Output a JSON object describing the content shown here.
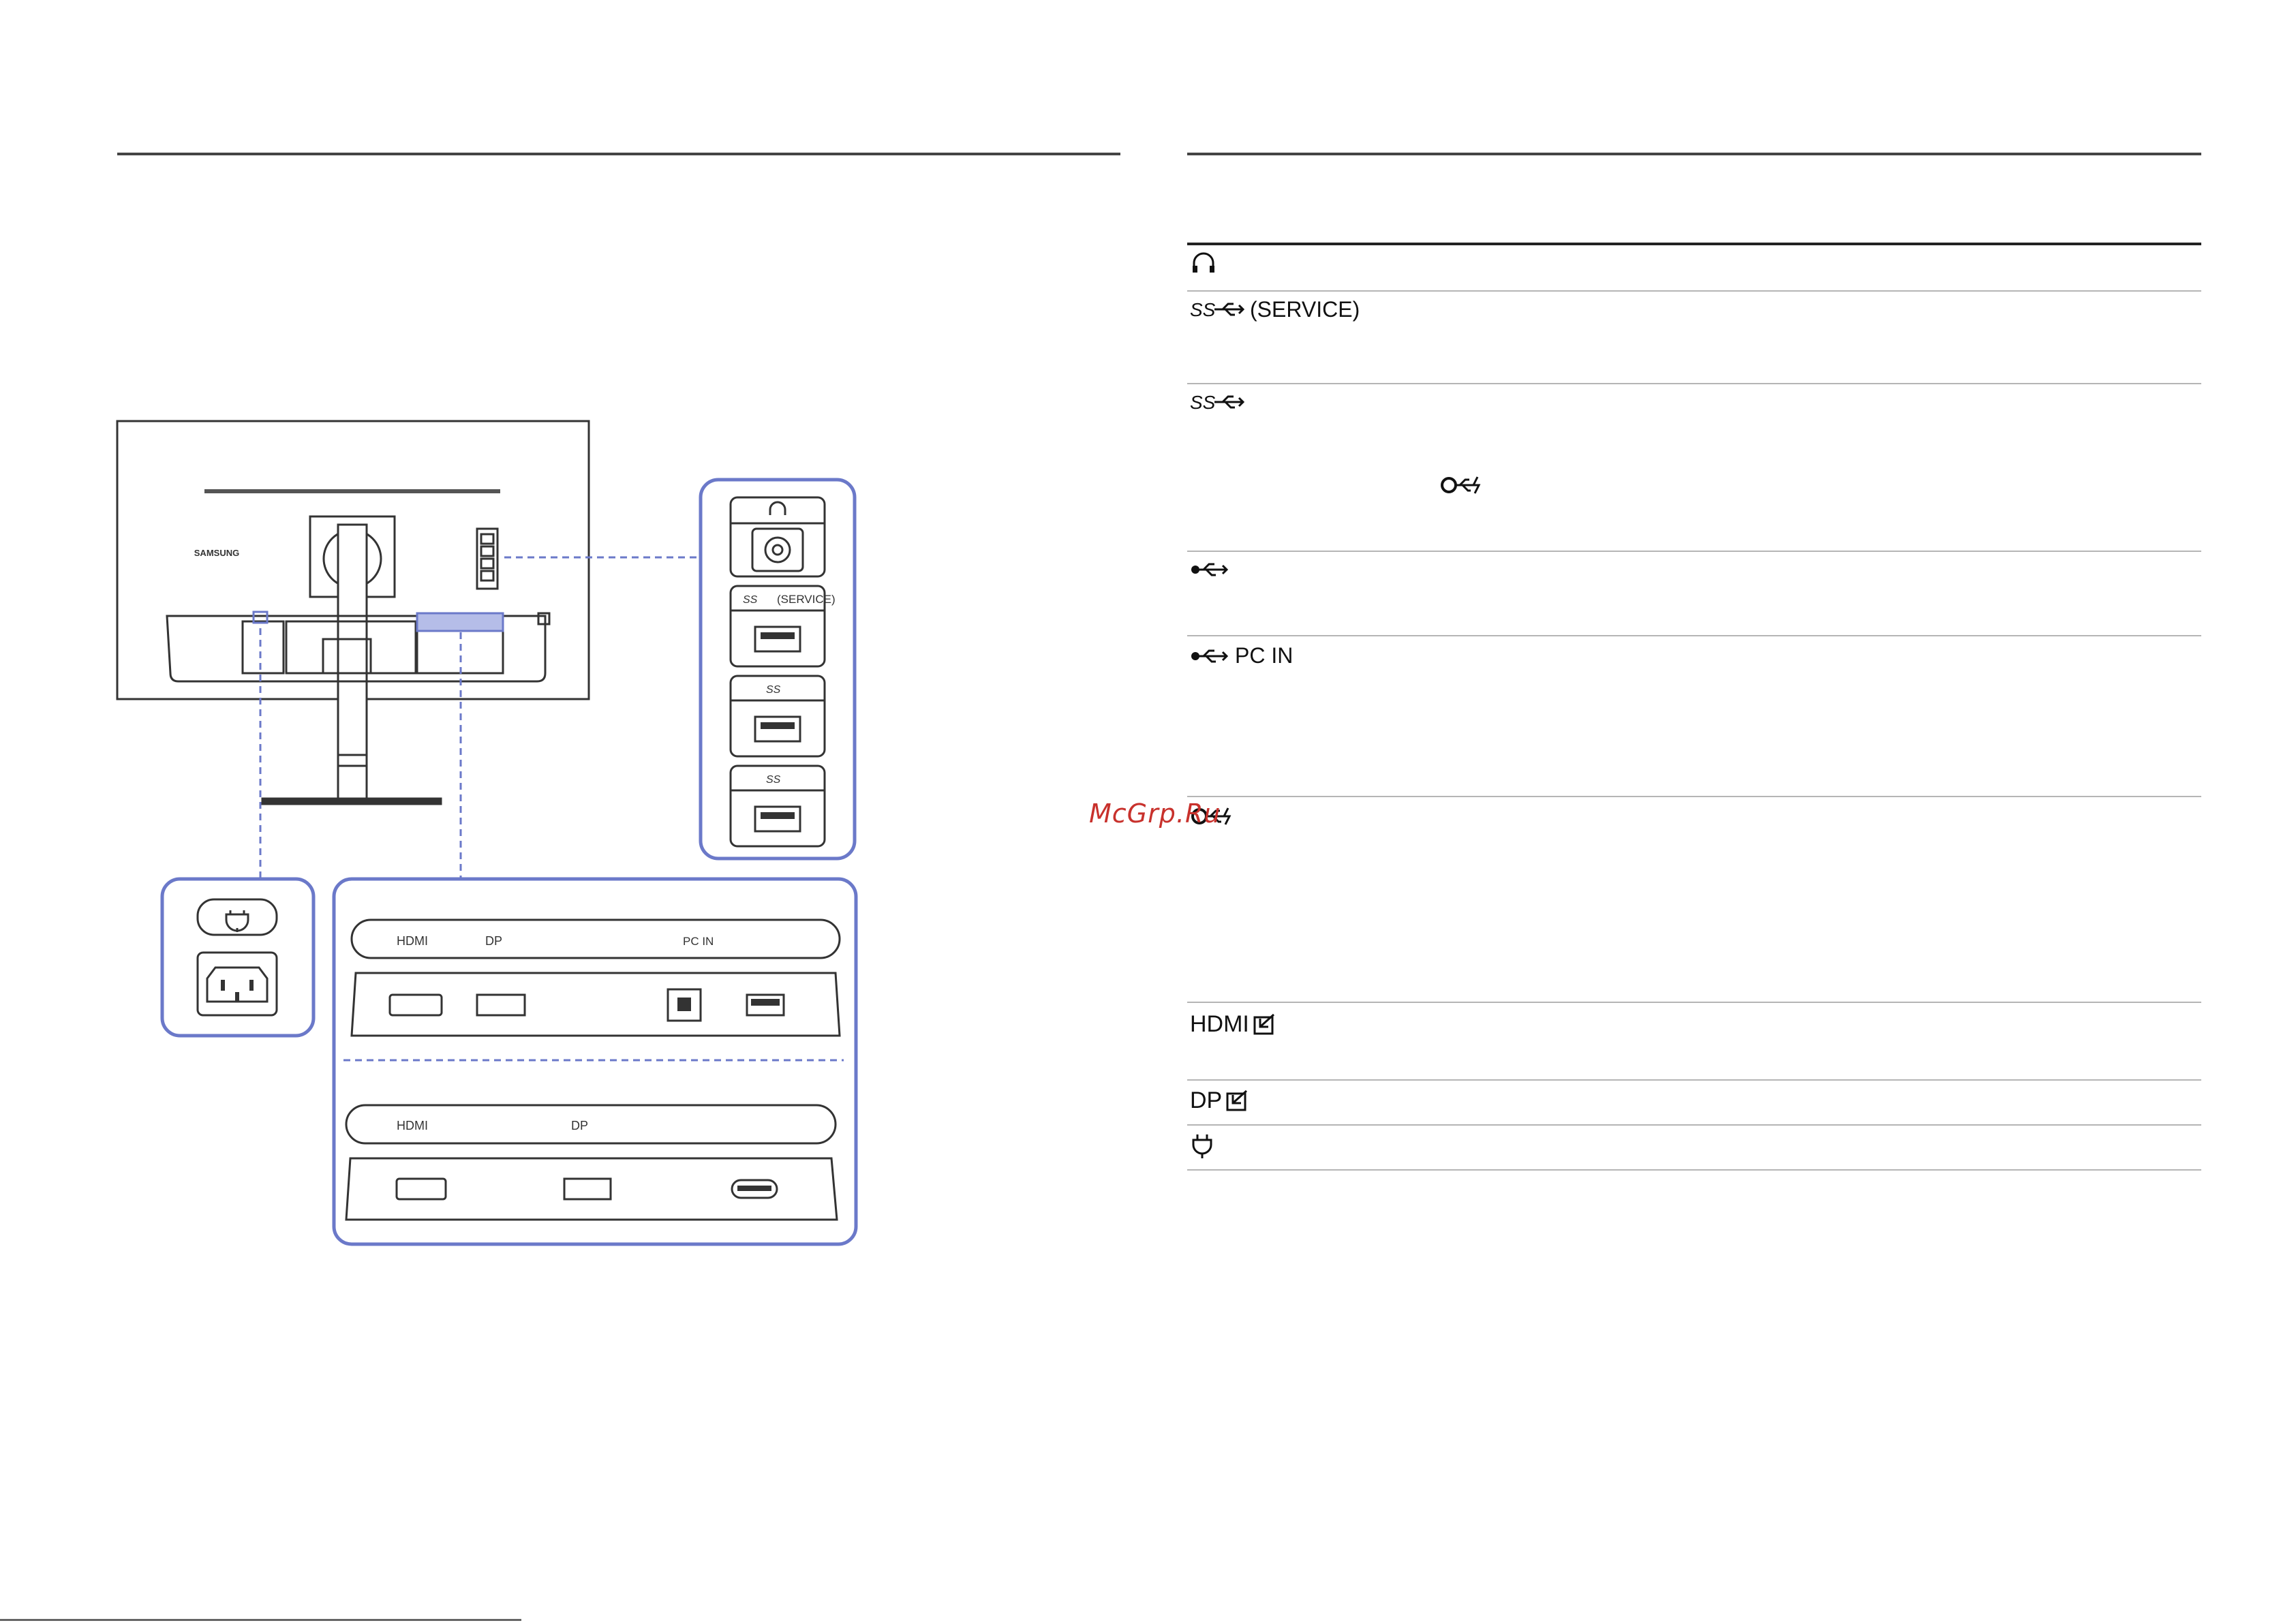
{
  "diagram": {
    "brand": "SAMSUNG",
    "side_panel": {
      "headphone_icon": "headphone-icon",
      "usb_service_label": "(SERVICE)"
    },
    "power_panel": {
      "power_icon": "power-plug-icon"
    },
    "bottom_panel_a": {
      "hdmi": "HDMI",
      "dp": "DP",
      "pc_in": "PC IN"
    },
    "bottom_panel_b": {
      "hdmi": "HDMI",
      "dp": "DP"
    }
  },
  "table": {
    "rows": [
      {
        "icon": "headphone-icon",
        "label": ""
      },
      {
        "icon": "usb-superspeed-icon",
        "label": "(SERVICE)"
      },
      {
        "icon": "usb-superspeed-icon",
        "label": "",
        "inline_icon": "usb-c-power-icon"
      },
      {
        "icon": "usb-icon",
        "label": ""
      },
      {
        "icon": "usb-icon",
        "label": "PC IN"
      },
      {
        "icon": "usb-c-power-icon",
        "label": ""
      },
      {
        "icon": "hdmi-input-icon",
        "label": "HDMI"
      },
      {
        "icon": "dp-input-icon",
        "label": "DP"
      },
      {
        "icon": "power-plug-icon",
        "label": ""
      }
    ]
  },
  "watermark": "McGrp.Ru"
}
